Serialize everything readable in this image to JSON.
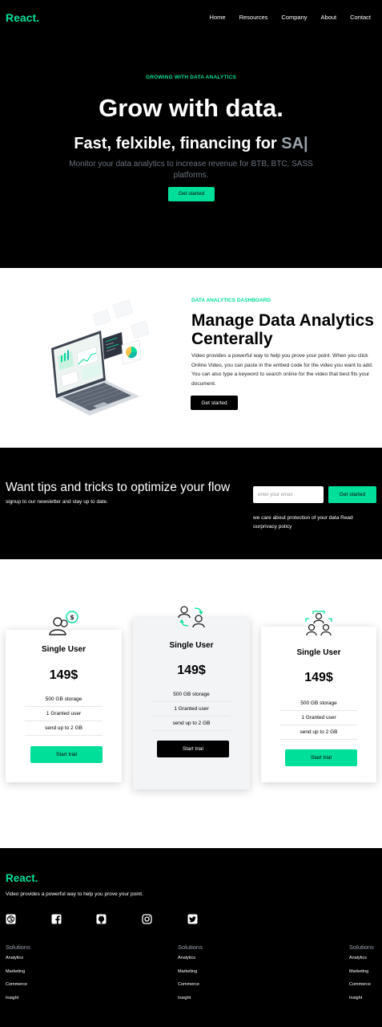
{
  "nav": {
    "logo": "React.",
    "links": [
      "Home",
      "Resources",
      "Company",
      "About",
      "Contact"
    ]
  },
  "hero": {
    "eyebrow": "GROWING WITH DATA ANALYTICS",
    "title": "Grow with data.",
    "subtitle_prefix": "Fast, felxible, financing for ",
    "subtitle_typed": "SA|",
    "description": "Monitor your data analytics to increase revenue for BTB, BTC, SASS platforms.",
    "button": "Get started"
  },
  "analytics": {
    "eyebrow": "DATA ANALYTICS DASHBOARD",
    "title": "Manage Data Analytics Centerally",
    "description": "Video provides a powerful way to help you prove your point. When you click Online Video, you can paste in the embed code for the video you want to add. You can also type a keyword to search online for the video that best fits your document.",
    "button": "Get started",
    "image_icon": "laptop-dashboard-illustration"
  },
  "newsletter": {
    "title": "Want tips and tricks to optimize your flow",
    "subtitle": "signup to our newsletter and stay up to date.",
    "input_placeholder": "enter your email",
    "button": "Get started",
    "note": "we care about protection of your data Read ourprivacy policy"
  },
  "pricing": {
    "cards": [
      {
        "icon": "user-dollar-icon",
        "name": "Single User",
        "price": "149$",
        "features": [
          "500 GB storage",
          "1 Granted user",
          "send up to 2 GB"
        ],
        "button": "Start trial"
      },
      {
        "icon": "users-exchange-icon",
        "name": "Single User",
        "price": "149$",
        "features": [
          "500 GB storage",
          "1 Granted user",
          "send up to 2 GB"
        ],
        "button": "Start trial"
      },
      {
        "icon": "team-icon",
        "name": "Single User",
        "price": "149$",
        "features": [
          "500 GB storage",
          "1 Granted user",
          "send up to 2 GB"
        ],
        "button": "Start trial"
      }
    ]
  },
  "footer": {
    "logo": "React.",
    "description": "Video provides a powerful way to help you prove your point.",
    "social_icons": [
      "dribbble-icon",
      "facebook-icon",
      "github-icon",
      "instagram-icon",
      "twitter-icon"
    ],
    "columns": [
      {
        "title": "Solutions",
        "items": [
          "Analytics",
          "Marketing",
          "Commerce",
          "Insight"
        ]
      },
      {
        "title": "Solutions",
        "items": [
          "Analytics",
          "Marketing",
          "Commerce",
          "Insight"
        ]
      },
      {
        "title": "Solutions",
        "items": [
          "Analytics",
          "Marketing",
          "Commerce",
          "Insight"
        ]
      }
    ]
  },
  "colors": {
    "accent": "#00df9a",
    "background_dark": "#000000",
    "background_light": "#ffffff"
  }
}
